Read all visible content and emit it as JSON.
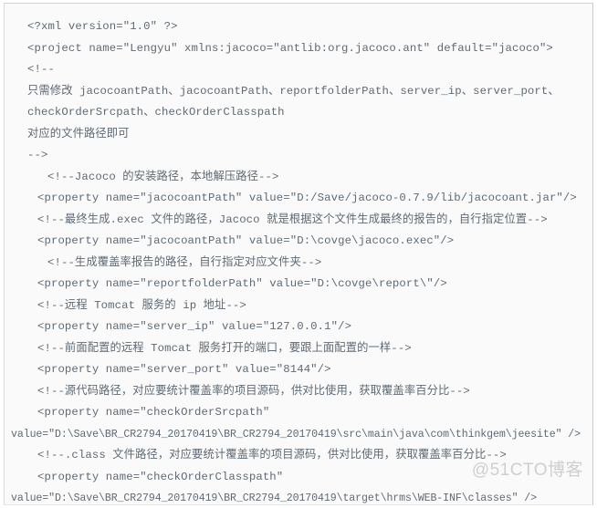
{
  "document": {
    "type": "xml-source-listing",
    "language": "XML / Ant build script",
    "colors": {
      "background": "#fafafa",
      "page_background": "#ffffff",
      "text": "#5e6a75",
      "border": "#d2d2d2",
      "watermark": "#cfcfcf"
    },
    "watermark": "@51CTO博客"
  },
  "code": {
    "lines": [
      {
        "indent": 1,
        "text": "<?xml version=\"1.0\" ?>"
      },
      {
        "indent": 1,
        "text": "<project name=\"Lengyu\" xmlns:jacoco=\"antlib:org.jacoco.ant\" default=\"jacoco\">"
      },
      {
        "indent": 1,
        "text": "<!--"
      },
      {
        "indent": 1,
        "text": "只需修改 jacocoantPath、jacocoantPath、reportfolderPath、server_ip、server_port、"
      },
      {
        "indent": 1,
        "text": "checkOrderSrcpath、checkOrderClasspath"
      },
      {
        "indent": 1,
        "text": "对应的文件路径即可"
      },
      {
        "indent": 1,
        "text": "-->"
      },
      {
        "indent": 3,
        "text": "<!--Jacoco 的安装路径，本地解压路径-->"
      },
      {
        "indent": 2,
        "text": "<property name=\"jacocoantPath\" value=\"D:/Save/jacoco-0.7.9/lib/jacocoant.jar\"/>"
      },
      {
        "indent": 2,
        "text": "<!--最终生成.exec 文件的路径，Jacoco 就是根据这个文件生成最终的报告的，自行指定位置-->"
      },
      {
        "indent": 2,
        "text": "<property name=\"jacocoantPath\" value=\"D:\\covge\\jacoco.exec\"/>"
      },
      {
        "indent": 3,
        "text": "<!--生成覆盖率报告的路径，自行指定对应文件夹-->"
      },
      {
        "indent": 2,
        "text": "<property name=\"reportfolderPath\" value=\"D:\\covge\\report\\\"/>"
      },
      {
        "indent": 2,
        "text": "<!--远程 Tomcat 服务的 ip 地址-->"
      },
      {
        "indent": 2,
        "text": "<property name=\"server_ip\" value=\"127.0.0.1\"/>"
      },
      {
        "indent": 2,
        "text": "<!--前面配置的远程 Tomcat 服务打开的端口，要跟上面配置的一样-->"
      },
      {
        "indent": 2,
        "text": "<property name=\"server_port\" value=\"8144\"/>"
      },
      {
        "indent": 2,
        "text": "<!--源代码路径，对应要统计覆盖率的项目源码，供对比使用，获取覆盖率百分比-->"
      },
      {
        "indent": 2,
        "text": "<property name=\"checkOrderSrcpath\""
      },
      {
        "indent": 0,
        "tight": true,
        "text": "value=\"D:\\Save\\BR_CR2794_20170419\\BR_CR2794_20170419\\src\\main\\java\\com\\thinkgem\\jeesite\" />"
      },
      {
        "indent": 2,
        "text": "<!--.class 文件路径，对应要统计覆盖率的项目源码，供对比使用，获取覆盖率百分比-->"
      },
      {
        "indent": 2,
        "text": "<property name=\"checkOrderClasspath\""
      },
      {
        "indent": 0,
        "tight": true,
        "text": "value=\"D:\\Save\\BR_CR2794_20170419\\BR_CR2794_20170419\\target\\hrms\\WEB-INF\\classes\" />"
      }
    ]
  }
}
